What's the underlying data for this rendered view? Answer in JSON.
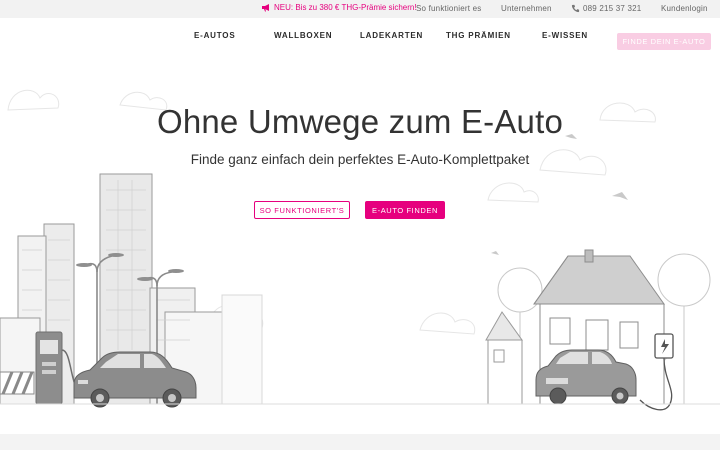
{
  "topbar": {
    "promo_icon": "megaphone-icon",
    "promo_text": "NEU: Bis zu 380 € THG-Prämie sichern!",
    "how_it_works": "So funktioniert es",
    "company": "Unternehmen",
    "phone_icon": "phone-icon",
    "phone": "089 215 37 321",
    "login": "Kundenlogin"
  },
  "nav": {
    "items": [
      {
        "label": "E-AUTOS"
      },
      {
        "label": "WALLBOXEN"
      },
      {
        "label": "LADEKARTEN"
      },
      {
        "label": "THG PRÄMIEN"
      },
      {
        "label": "E-WISSEN"
      }
    ],
    "cta": "FINDE DEIN E-AUTO"
  },
  "hero": {
    "title": "Ohne Umwege zum E-Auto",
    "subtitle": "Finde ganz einfach dein perfektes E-Auto-Komplettpaket",
    "btn_how": "SO FUNKTIONIERT'S",
    "btn_find": "E-AUTO FINDEN"
  },
  "colors": {
    "brand": "#e6007e",
    "brand_light": "#f9cde3",
    "topbar_bg": "#f2f2f2"
  }
}
